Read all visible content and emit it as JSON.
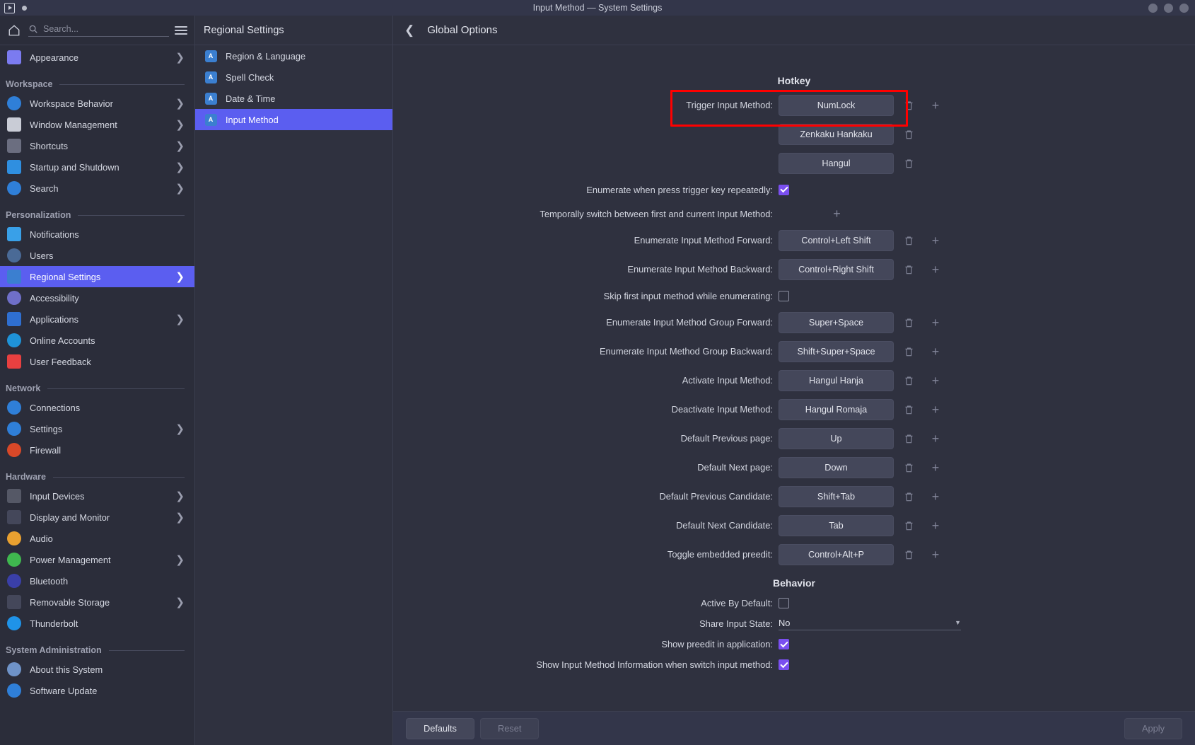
{
  "window": {
    "title": "Input Method — System Settings",
    "controls": [
      "minimize",
      "maximize",
      "close"
    ]
  },
  "sidebar": {
    "search": {
      "placeholder": "Search..."
    },
    "home_icon": "home-icon",
    "menu_icon": "hamburger-icon",
    "items": [
      {
        "label": "Appearance",
        "icon": "appearance-icon",
        "chevron": true,
        "color": "#7b7bf0"
      },
      {
        "group": "Workspace"
      },
      {
        "label": "Workspace Behavior",
        "icon": "workspace-behavior-icon",
        "chevron": true,
        "color": "#2f7fd8"
      },
      {
        "label": "Window Management",
        "icon": "window-management-icon",
        "chevron": true,
        "color": "#c9ccd6"
      },
      {
        "label": "Shortcuts",
        "icon": "shortcuts-icon",
        "chevron": true,
        "color": "#6b6e80"
      },
      {
        "label": "Startup and Shutdown",
        "icon": "startup-shutdown-icon",
        "chevron": true,
        "color": "#2f8fe0"
      },
      {
        "label": "Search",
        "icon": "search-sidebar-icon",
        "chevron": true,
        "color": "#2f7fd8"
      },
      {
        "group": "Personalization"
      },
      {
        "label": "Notifications",
        "icon": "notifications-icon",
        "chevron": false,
        "color": "#39a0e8"
      },
      {
        "label": "Users",
        "icon": "users-icon",
        "chevron": false,
        "color": "#4a6a96"
      },
      {
        "label": "Regional Settings",
        "icon": "regional-settings-icon",
        "chevron": true,
        "color": "#3b7fd0",
        "active": true
      },
      {
        "label": "Accessibility",
        "icon": "accessibility-icon",
        "chevron": false,
        "color": "#6f6fc8"
      },
      {
        "label": "Applications",
        "icon": "applications-icon",
        "chevron": true,
        "color": "#2f6fd0"
      },
      {
        "label": "Online Accounts",
        "icon": "online-accounts-icon",
        "chevron": false,
        "color": "#1f93d8"
      },
      {
        "label": "User Feedback",
        "icon": "user-feedback-icon",
        "chevron": false,
        "color": "#e84040"
      },
      {
        "group": "Network"
      },
      {
        "label": "Connections",
        "icon": "connections-icon",
        "chevron": false,
        "color": "#2f7fd8"
      },
      {
        "label": "Settings",
        "icon": "network-settings-icon",
        "chevron": true,
        "color": "#2f7fd8"
      },
      {
        "label": "Firewall",
        "icon": "firewall-icon",
        "chevron": false,
        "color": "#d84828"
      },
      {
        "group": "Hardware"
      },
      {
        "label": "Input Devices",
        "icon": "input-devices-icon",
        "chevron": true,
        "color": "#555866"
      },
      {
        "label": "Display and Monitor",
        "icon": "display-monitor-icon",
        "chevron": true,
        "color": "#44475a"
      },
      {
        "label": "Audio",
        "icon": "audio-icon",
        "chevron": false,
        "color": "#e8a030"
      },
      {
        "label": "Power Management",
        "icon": "power-management-icon",
        "chevron": true,
        "color": "#3fb84f"
      },
      {
        "label": "Bluetooth",
        "icon": "bluetooth-icon",
        "chevron": false,
        "color": "#3a3fa8"
      },
      {
        "label": "Removable Storage",
        "icon": "removable-storage-icon",
        "chevron": true,
        "color": "#44475a"
      },
      {
        "label": "Thunderbolt",
        "icon": "thunderbolt-icon",
        "chevron": false,
        "color": "#1f93e8"
      },
      {
        "group": "System Administration"
      },
      {
        "label": "About this System",
        "icon": "about-system-icon",
        "chevron": false,
        "color": "#6f93c8"
      },
      {
        "label": "Software Update",
        "icon": "software-update-icon",
        "chevron": false,
        "color": "#2f7fd8"
      }
    ]
  },
  "column2": {
    "title": "Regional Settings",
    "items": [
      {
        "label": "Region & Language",
        "icon": "region-language-icon",
        "active": false
      },
      {
        "label": "Spell Check",
        "icon": "spell-check-icon",
        "active": false
      },
      {
        "label": "Date & Time",
        "icon": "date-time-icon",
        "active": false
      },
      {
        "label": "Input Method",
        "icon": "input-method-icon",
        "active": true
      }
    ]
  },
  "main": {
    "back_icon": "back-chevron-icon",
    "title": "Global Options",
    "hotkey": {
      "section_title": "Hotkey",
      "trigger": {
        "label": "Trigger Input Method:",
        "values": [
          "NumLock",
          "Zenkaku Hankaku",
          "Hangul"
        ],
        "delete_icon": "trash-icon",
        "add_icon": "plus-icon"
      },
      "enumerate_repeat": {
        "label": "Enumerate when press trigger key repeatedly:",
        "checked": true
      },
      "temporal_switch": {
        "label": "Temporally switch between first and current Input Method:",
        "add_icon": "plus-icon"
      },
      "rows": [
        {
          "label": "Enumerate Input Method Forward:",
          "value": "Control+Left Shift",
          "delete": true,
          "add": true
        },
        {
          "label": "Enumerate Input Method Backward:",
          "value": "Control+Right Shift",
          "delete": true,
          "add": true
        }
      ],
      "skip_first": {
        "label": "Skip first input method while enumerating:",
        "checked": false
      },
      "rows2": [
        {
          "label": "Enumerate Input Method Group Forward:",
          "value": "Super+Space",
          "delete": true,
          "add": true
        },
        {
          "label": "Enumerate Input Method Group Backward:",
          "value": "Shift+Super+Space",
          "delete": true,
          "add": true
        },
        {
          "label": "Activate Input Method:",
          "value": "Hangul Hanja",
          "delete": true,
          "add": true
        },
        {
          "label": "Deactivate Input Method:",
          "value": "Hangul Romaja",
          "delete": true,
          "add": true
        },
        {
          "label": "Default Previous page:",
          "value": "Up",
          "delete": true,
          "add": true
        },
        {
          "label": "Default Next page:",
          "value": "Down",
          "delete": true,
          "add": true
        },
        {
          "label": "Default Previous Candidate:",
          "value": "Shift+Tab",
          "delete": true,
          "add": true
        },
        {
          "label": "Default Next Candidate:",
          "value": "Tab",
          "delete": true,
          "add": true
        },
        {
          "label": "Toggle embedded preedit:",
          "value": "Control+Alt+P",
          "delete": true,
          "add": true
        }
      ]
    },
    "behavior": {
      "section_title": "Behavior",
      "active_by_default": {
        "label": "Active By Default:",
        "checked": false
      },
      "share_input_state": {
        "label": "Share Input State:",
        "value": "No",
        "carat_icon": "chevron-down-icon"
      },
      "show_preedit": {
        "label": "Show preedit in application:",
        "checked": true
      },
      "show_info": {
        "label": "Show Input Method Information when switch input method:",
        "checked": true
      }
    },
    "annotation": {
      "type": "red-highlight-box",
      "color": "#ff0000"
    }
  },
  "footer": {
    "defaults_label": "Defaults",
    "reset_label": "Reset",
    "apply_label": "Apply"
  }
}
